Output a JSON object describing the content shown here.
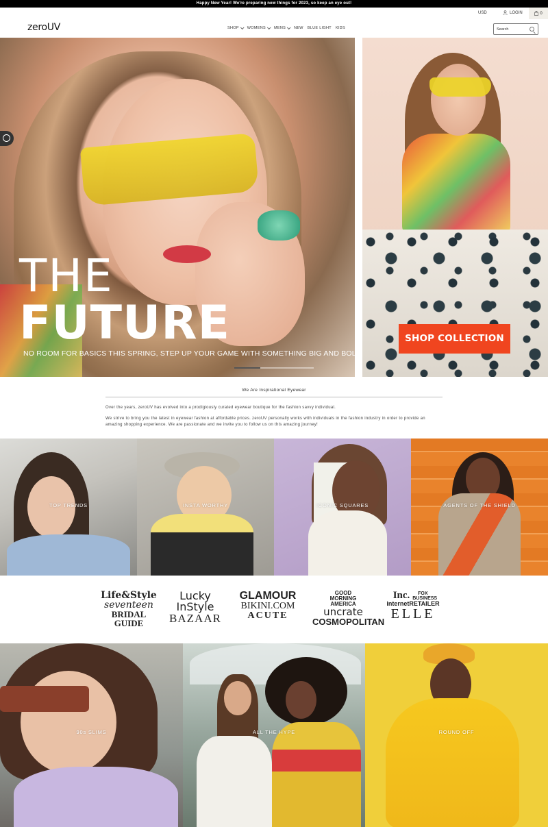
{
  "announcement": "Happy New Year! We're preparing new things for 2023, so keep an eye out!",
  "topbar": {
    "currency": "USD",
    "login": "LOGIN",
    "cart_count": "0"
  },
  "header": {
    "logo": "zeroUV",
    "nav": [
      "SHOP",
      "WOMENS",
      "MENS",
      "NEW",
      "BLUE LIGHT",
      "KIDS"
    ],
    "search_placeholder": "Search"
  },
  "hero": {
    "line1": "THE",
    "line2": "FUTURE",
    "subtitle": "NO ROOM FOR BASICS THIS SPRING, STEP UP YOUR GAME WITH SOMETHING BIG AND BOLD",
    "cta": "SHOP COLLECTION"
  },
  "about": {
    "title": "We Are Inspirational Eyewear",
    "p1": "Over the years, zeroUV has evolved into a prodigiously curated eyewear boutique for the fashion savvy individual.",
    "p2": "We strive to bring you the latest in eyewear fashion at affordable prices. zeroUV personally works with individuals in the fashion industry in order to provide an amazing shopping experience. We are passionate and we invite you to follow us on this amazing journey!"
  },
  "categories": [
    "TOP TRENDS",
    "INSTA WORTHY",
    "ICONIC SQUARES",
    "AGENTS OF THE SHIELD"
  ],
  "press": [
    [
      "Life&Style",
      "seventeen",
      "BRIDAL GUIDE"
    ],
    [
      "Lucky",
      "InStyle",
      "BAZAAR"
    ],
    [
      "GLAMOUR",
      "BIKINI.COM",
      "ACUTE"
    ],
    [
      "GOOD MORNING AMERICA",
      "uncrate",
      "COSMOPOLITAN"
    ],
    [
      "Inc.",
      "FOX BUSINESS",
      "internetRETAILER",
      "ELLE"
    ]
  ],
  "collections": [
    "90s SLIMS",
    "ALL THE HYPE",
    "ROUND OFF"
  ],
  "colors": {
    "cta": "#f0451f",
    "announcement_bg": "#000000"
  }
}
